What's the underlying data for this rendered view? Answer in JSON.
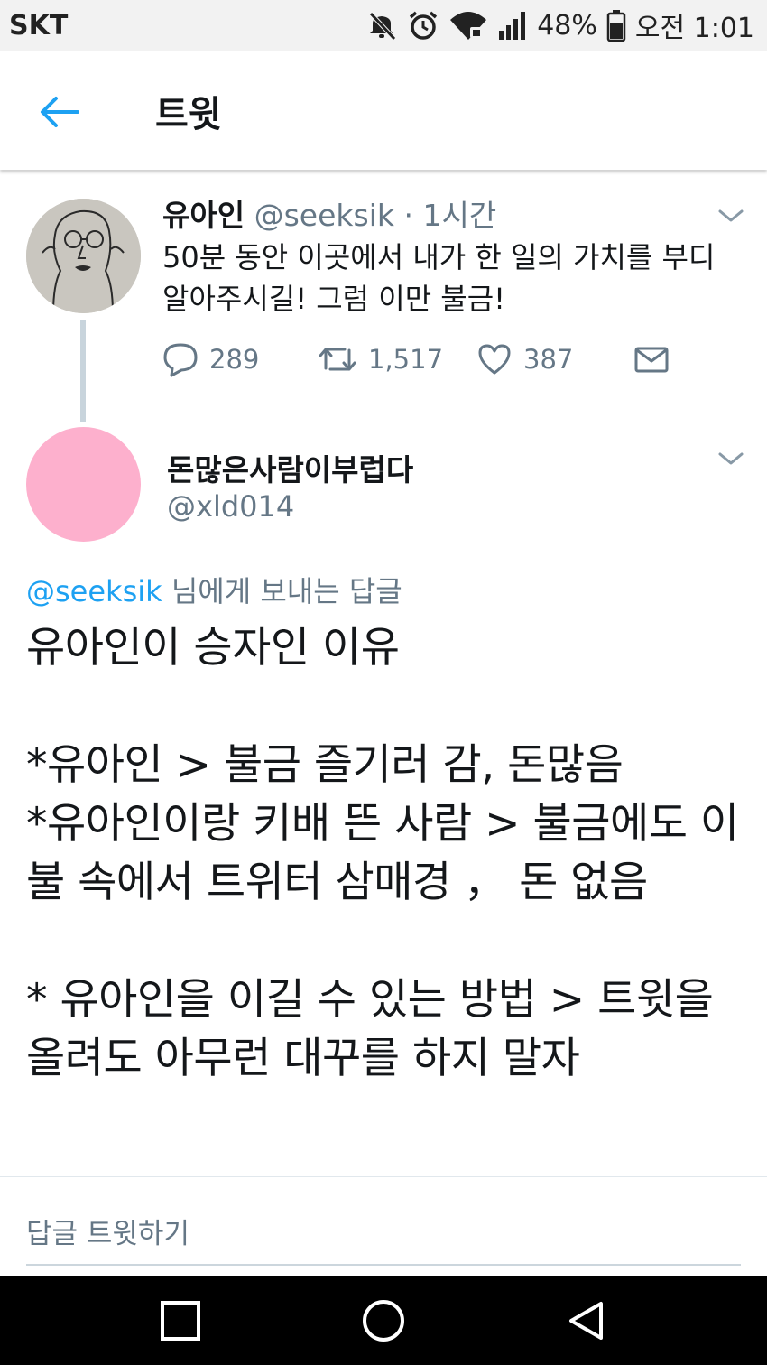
{
  "status_bar": {
    "carrier": "SKT",
    "battery_percent": "48%",
    "time": "오전 1:01",
    "icons": [
      "mute-icon",
      "alarm-icon",
      "wifi-icon",
      "signal-icon",
      "battery-icon"
    ]
  },
  "header": {
    "title": "트윗",
    "back_icon": "back-arrow-icon"
  },
  "parent_tweet": {
    "name": "유아인",
    "handle": "@seeksik",
    "separator": "·",
    "time": "1시간",
    "text": "50분 동안 이곳에서 내가 한 일의 가치를 부디 알아주시길! 그럼 이만 불금!",
    "replies": "289",
    "retweets": "1,517",
    "likes": "387"
  },
  "main_tweet": {
    "name": "돈많은사람이부럽다",
    "handle": "@xld014",
    "reply_to_handle": "@seeksik",
    "reply_to_suffix": " 님에게 보내는 답글",
    "text": "유아인이 승자인 이유\n\n*유아인 > 불금 즐기러 감, 돈많음\n*유아인이랑 키배 뜬 사람 > 불금에도 이불 속에서 트위터 삼매경 ， 돈 없음\n\n* 유아인을 이길 수 있는 방법 > 트윗을 올려도 아무런 대꾸를 하지 말자",
    "avatar_color": "#fdb0cd"
  },
  "composer": {
    "placeholder": "답글 트윗하기"
  },
  "colors": {
    "accent": "#1da1f2",
    "secondary_text": "#657786",
    "primary_text": "#14171a"
  }
}
